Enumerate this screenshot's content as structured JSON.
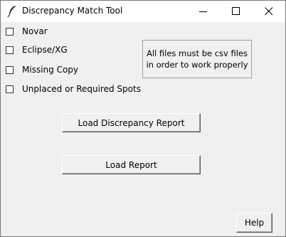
{
  "window": {
    "title": "Discrepancy Match Tool",
    "app_icon": "feather-icon",
    "controls": {
      "minimize": "minimize-icon",
      "maximize": "maximize-icon",
      "close": "close-icon"
    }
  },
  "checkboxes": [
    {
      "label": "Novar",
      "checked": false
    },
    {
      "label": "Eclipse/XG",
      "checked": false
    },
    {
      "label": "Missing Copy",
      "checked": false
    },
    {
      "label": "Unplaced or Required Spots",
      "checked": false
    }
  ],
  "info": {
    "line1": "All files must be csv files",
    "line2": "in order to work properly"
  },
  "buttons": {
    "load_discrepancy": "Load Discrepancy Report",
    "load_report": "Load Report",
    "help": "Help"
  }
}
